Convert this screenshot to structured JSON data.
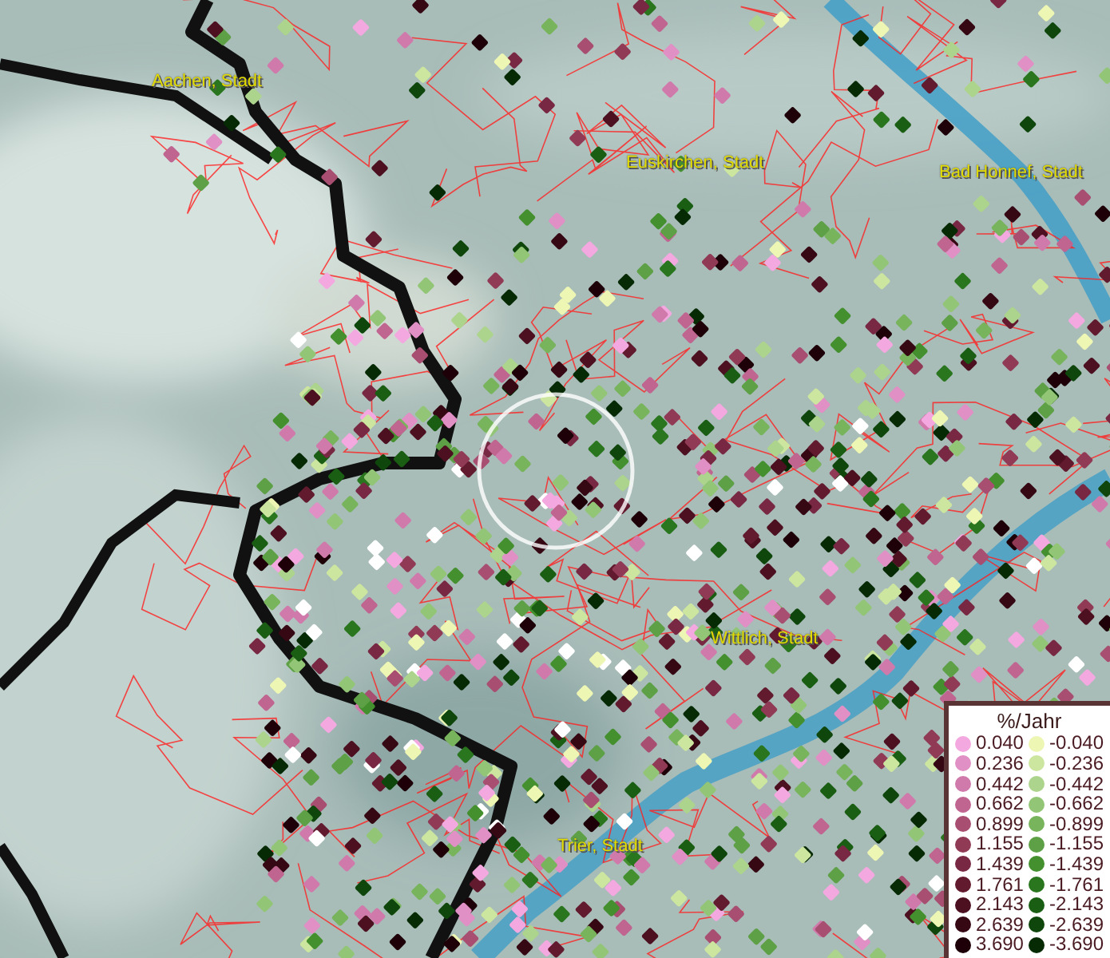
{
  "cities": [
    {
      "label": "Aachen, Stadt"
    },
    {
      "label": "Euskirchen, Stadt"
    },
    {
      "label": "Bad Honnef, Stadt"
    },
    {
      "label": "Wittlich, Stadt"
    },
    {
      "label": "Trier, Stadt"
    }
  ],
  "legend": {
    "title": "%/Jahr",
    "entries": [
      {
        "positive": {
          "value": "0.040",
          "color": "#f4a8e0"
        },
        "negative": {
          "value": "-0.040",
          "color": "#eef6b4"
        }
      },
      {
        "positive": {
          "value": "0.236",
          "color": "#e090c4"
        },
        "negative": {
          "value": "-0.236",
          "color": "#cce6a0"
        }
      },
      {
        "positive": {
          "value": "0.442",
          "color": "#d07aac"
        },
        "negative": {
          "value": "-0.442",
          "color": "#acd48c"
        }
      },
      {
        "positive": {
          "value": "0.662",
          "color": "#c06490"
        },
        "negative": {
          "value": "-0.662",
          "color": "#92c676"
        }
      },
      {
        "positive": {
          "value": "0.899",
          "color": "#a84e70"
        },
        "negative": {
          "value": "-0.899",
          "color": "#78b45c"
        }
      },
      {
        "positive": {
          "value": "1.155",
          "color": "#903a56"
        },
        "negative": {
          "value": "-1.155",
          "color": "#5ea046"
        }
      },
      {
        "positive": {
          "value": "1.439",
          "color": "#782842"
        },
        "negative": {
          "value": "-1.439",
          "color": "#44902e"
        }
      },
      {
        "positive": {
          "value": "1.761",
          "color": "#621a2e"
        },
        "negative": {
          "value": "-1.761",
          "color": "#2a761e"
        }
      },
      {
        "positive": {
          "value": "2.143",
          "color": "#4c1020"
        },
        "negative": {
          "value": "-2.143",
          "color": "#1a5e14"
        }
      },
      {
        "positive": {
          "value": "2.639",
          "color": "#360814"
        },
        "negative": {
          "value": "-2.639",
          "color": "#0e460c"
        }
      },
      {
        "positive": {
          "value": "3.690",
          "color": "#1e0008"
        },
        "negative": {
          "value": "-3.690",
          "color": "#062a04"
        }
      }
    ]
  }
}
